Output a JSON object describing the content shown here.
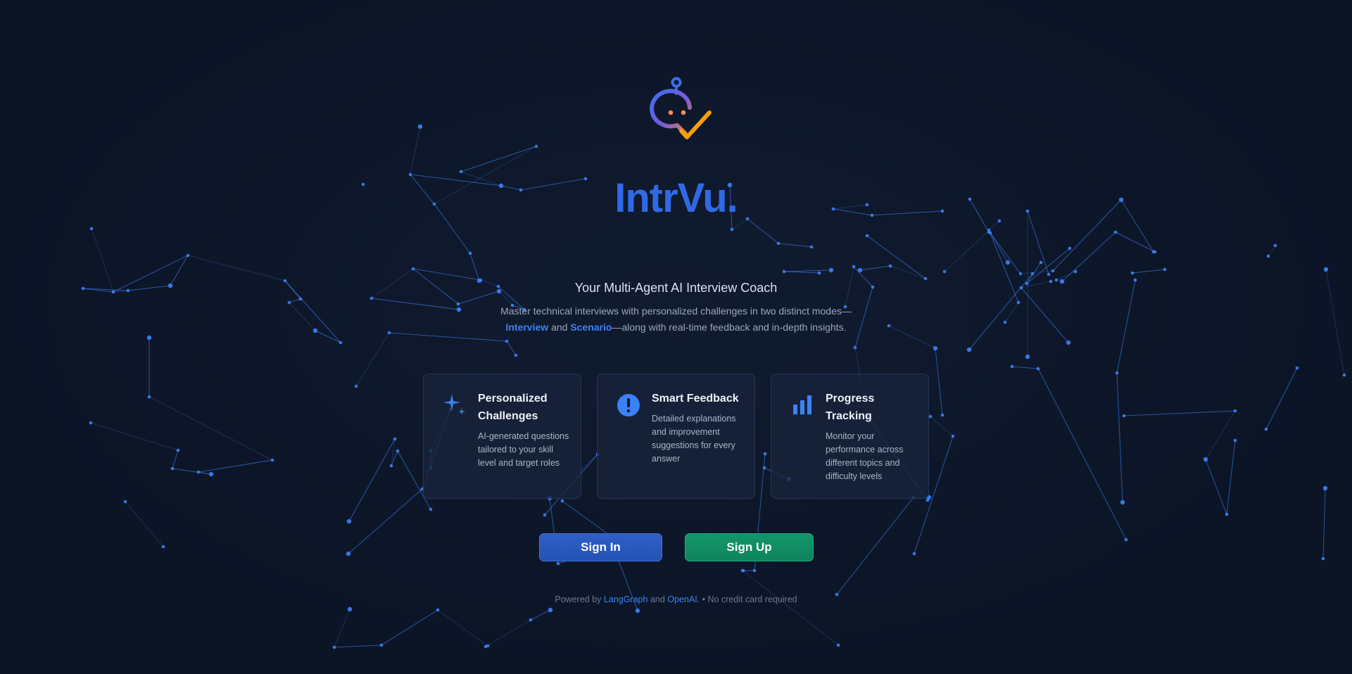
{
  "brand": {
    "name": "IntrVu."
  },
  "hero": {
    "tagline": "Your Multi-Agent AI Interview Coach",
    "description_prefix": "Master technical interviews with personalized challenges in two distinct modes—",
    "mode_interview": "Interview",
    "and_word": "and",
    "mode_scenario": "Scenario",
    "description_suffix": "—along with real-time feedback and in-depth insights."
  },
  "features": [
    {
      "icon": "sparkle-icon",
      "title": "Personalized Challenges",
      "text": "AI-generated questions tailored to your skill level and target roles"
    },
    {
      "icon": "exclamation-icon",
      "title": "Smart Feedback",
      "text": "Detailed explanations and improvement suggestions for every answer"
    },
    {
      "icon": "bar-chart-icon",
      "title": "Progress Tracking",
      "text": "Monitor your performance across different topics and difficulty levels"
    }
  ],
  "actions": {
    "sign_in": "Sign In",
    "sign_up": "Sign Up"
  },
  "footer": {
    "powered_by": "Powered by",
    "langgraph": "LangGraph",
    "and_word": "and",
    "openai": "OpenAI",
    "note": ". • No credit card required"
  },
  "colors": {
    "background": "#0d1628",
    "accent_blue": "#2f6ae6",
    "network_blue": "#3b82f6",
    "signup_green": "#10906a",
    "logo_orange": "#f59e0b"
  }
}
